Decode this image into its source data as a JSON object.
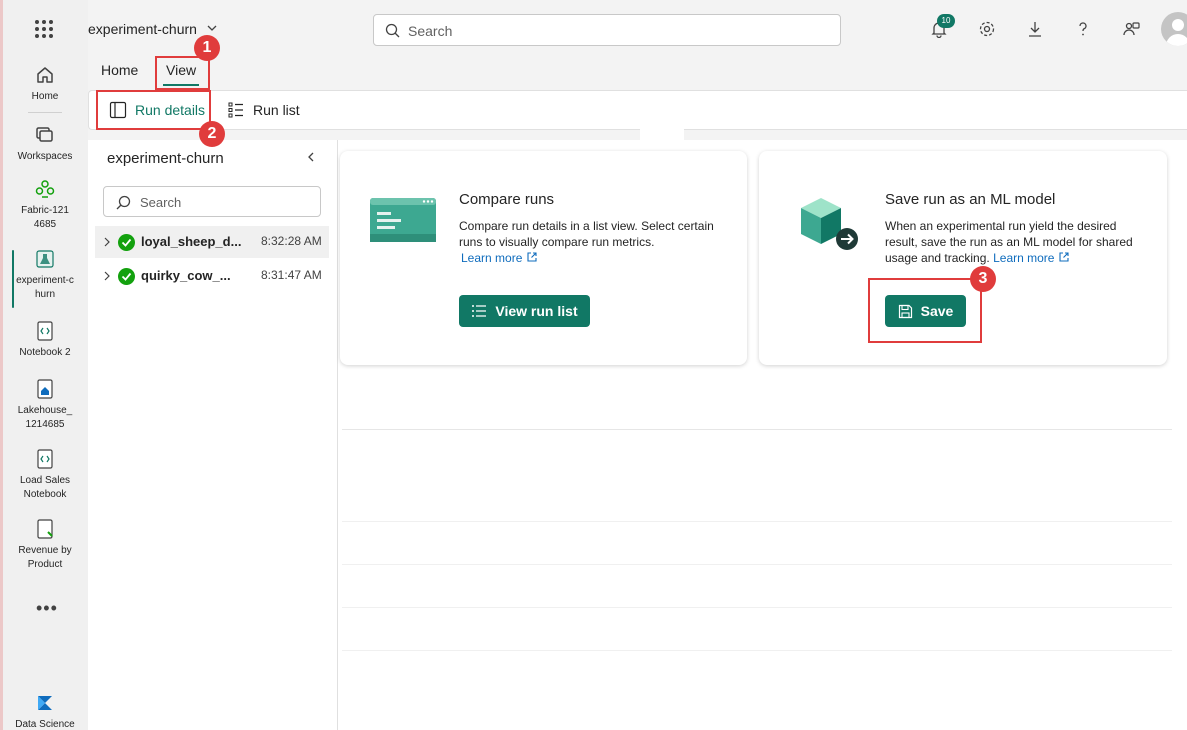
{
  "workspace": {
    "name": "experiment-churn"
  },
  "search": {
    "placeholder": "Search"
  },
  "notifications": {
    "count": "10"
  },
  "rail": {
    "items": [
      {
        "label": "Home"
      },
      {
        "label": "Workspaces"
      },
      {
        "label": "Fabric-1214685"
      },
      {
        "label": "experiment-churn"
      },
      {
        "label": "Notebook 2"
      },
      {
        "label": "Lakehouse_1214685"
      },
      {
        "label": "Load Sales Notebook"
      },
      {
        "label": "Revenue by Product"
      },
      {
        "label": "Data Science"
      }
    ],
    "more": "•••"
  },
  "tabs": [
    {
      "label": "Home"
    },
    {
      "label": "View"
    }
  ],
  "ribbon": {
    "run_details": "Run details",
    "run_list": "Run list"
  },
  "annotations": [
    "1",
    "2",
    "3"
  ],
  "panel": {
    "title": "experiment-churn",
    "search_placeholder": "Search",
    "runs": [
      {
        "name": "loyal_sheep_d...",
        "time": "8:32:28 AM"
      },
      {
        "name": "quirky_cow_...",
        "time": "8:31:47 AM"
      }
    ]
  },
  "cards": {
    "compare": {
      "title": "Compare runs",
      "description": "Compare run details in a list view. Select certain runs to visually compare run metrics.",
      "learn_more": "Learn more",
      "button": "View run list"
    },
    "save": {
      "title": "Save run as an ML model",
      "description": "When an experimental run yield the desired result, save the run as an ML model for shared usage and tracking.",
      "learn_more": "Learn more",
      "button": "Save"
    }
  },
  "colors": {
    "accent": "#117865",
    "annotation": "#e03c3c",
    "success": "#13a10e",
    "link": "#0f6cbd"
  }
}
